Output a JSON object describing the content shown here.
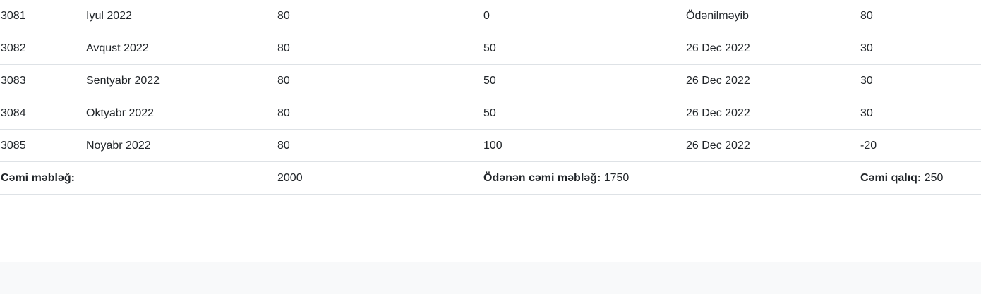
{
  "rows": [
    {
      "id": "3081",
      "month": "Iyul 2022",
      "amount": "80",
      "paid": "0",
      "date": "Ödənilməyib",
      "remaining": "80"
    },
    {
      "id": "3082",
      "month": "Avqust 2022",
      "amount": "80",
      "paid": "50",
      "date": "26 Dec 2022",
      "remaining": "30"
    },
    {
      "id": "3083",
      "month": "Sentyabr 2022",
      "amount": "80",
      "paid": "50",
      "date": "26 Dec 2022",
      "remaining": "30"
    },
    {
      "id": "3084",
      "month": "Oktyabr 2022",
      "amount": "80",
      "paid": "50",
      "date": "26 Dec 2022",
      "remaining": "30"
    },
    {
      "id": "3085",
      "month": "Noyabr 2022",
      "amount": "80",
      "paid": "100",
      "date": "26 Dec 2022",
      "remaining": "-20"
    }
  ],
  "totals": {
    "total_label": "Cəmi məbləğ:",
    "total_value": "2000",
    "paid_label": "Ödənən cəmi məbləğ:",
    "paid_value": "1750",
    "remaining_label": "Cəmi qalıq:",
    "remaining_value": "250"
  }
}
